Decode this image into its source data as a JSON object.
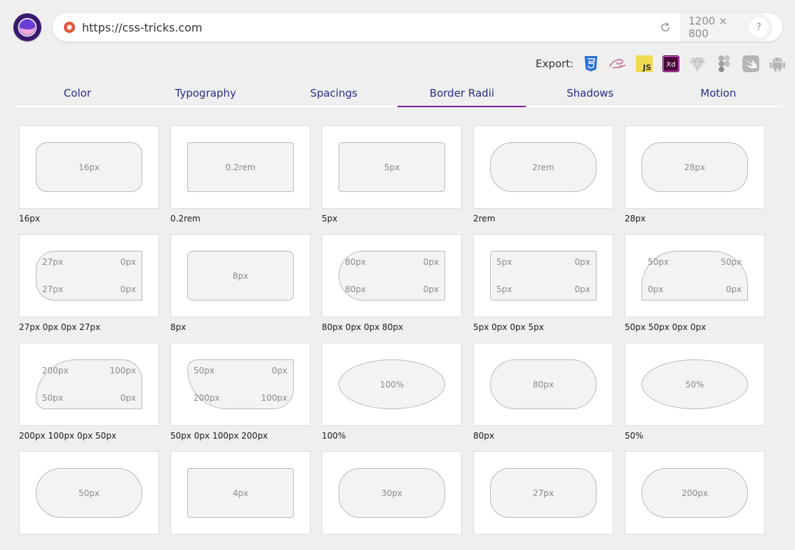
{
  "address_bar": {
    "url": "https://css-tricks.com",
    "viewport_size": "1200 × 800",
    "help_label": "?"
  },
  "export": {
    "label": "Export:",
    "icons": [
      "css3-icon",
      "sass-icon",
      "javascript-icon",
      "adobe-xd-icon",
      "sketch-icon",
      "figma-icon",
      "swift-icon",
      "android-icon"
    ]
  },
  "tabs": [
    {
      "label": "Color"
    },
    {
      "label": "Typography"
    },
    {
      "label": "Spacings"
    },
    {
      "label": "Border Radii",
      "active": true
    },
    {
      "label": "Shadows"
    },
    {
      "label": "Motion"
    }
  ],
  "colors": {
    "accent": "#7a1fa2",
    "tab_text": "#2a2a8a",
    "logo": "#3b1a6e"
  },
  "radii": [
    {
      "label": "16px",
      "radius": "16px",
      "text": "16px"
    },
    {
      "label": "0.2rem",
      "radius": "0.2rem",
      "text": "0.2rem"
    },
    {
      "label": "5px",
      "radius": "5px",
      "text": "5px"
    },
    {
      "label": "2rem",
      "radius": "2rem",
      "text": "2rem"
    },
    {
      "label": "28px",
      "radius": "28px",
      "text": "28px"
    },
    {
      "label": "27px 0px 0px 27px",
      "radius": "27px 0px 0px 27px",
      "corners": [
        "27px",
        "0px",
        "27px",
        "0px"
      ]
    },
    {
      "label": "8px",
      "radius": "8px",
      "text": "8px"
    },
    {
      "label": "80px 0px 0px 80px",
      "radius": "80px 0px 0px 80px",
      "corners": [
        "80px",
        "0px",
        "80px",
        "0px"
      ]
    },
    {
      "label": "5px 0px 0px 5px",
      "radius": "5px 0px 0px 5px",
      "corners": [
        "5px",
        "0px",
        "5px",
        "0px"
      ]
    },
    {
      "label": "50px 50px 0px 0px",
      "radius": "50px 50px 0px 0px",
      "corners": [
        "50px",
        "50px",
        "0px",
        "0px"
      ]
    },
    {
      "label": "200px 100px 0px 50px",
      "radius": "200px 100px 0px 50px",
      "corners": [
        "200px",
        "100px",
        "50px",
        "0px"
      ]
    },
    {
      "label": "50px 0px 100px 200px",
      "radius": "50px 0px 100px 200px",
      "corners": [
        "50px",
        "0px",
        "200px",
        "100px"
      ]
    },
    {
      "label": "100%",
      "radius": "100%",
      "text": "100%"
    },
    {
      "label": "80px",
      "radius": "80px",
      "text": "80px"
    },
    {
      "label": "50%",
      "radius": "50%",
      "text": "50%"
    },
    {
      "label": "",
      "radius": "50px",
      "text": "50px"
    },
    {
      "label": "",
      "radius": "4px",
      "text": "4px"
    },
    {
      "label": "",
      "radius": "30px",
      "text": "30px"
    },
    {
      "label": "",
      "radius": "27px",
      "text": "27px"
    },
    {
      "label": "",
      "radius": "200px",
      "text": "200px"
    }
  ]
}
